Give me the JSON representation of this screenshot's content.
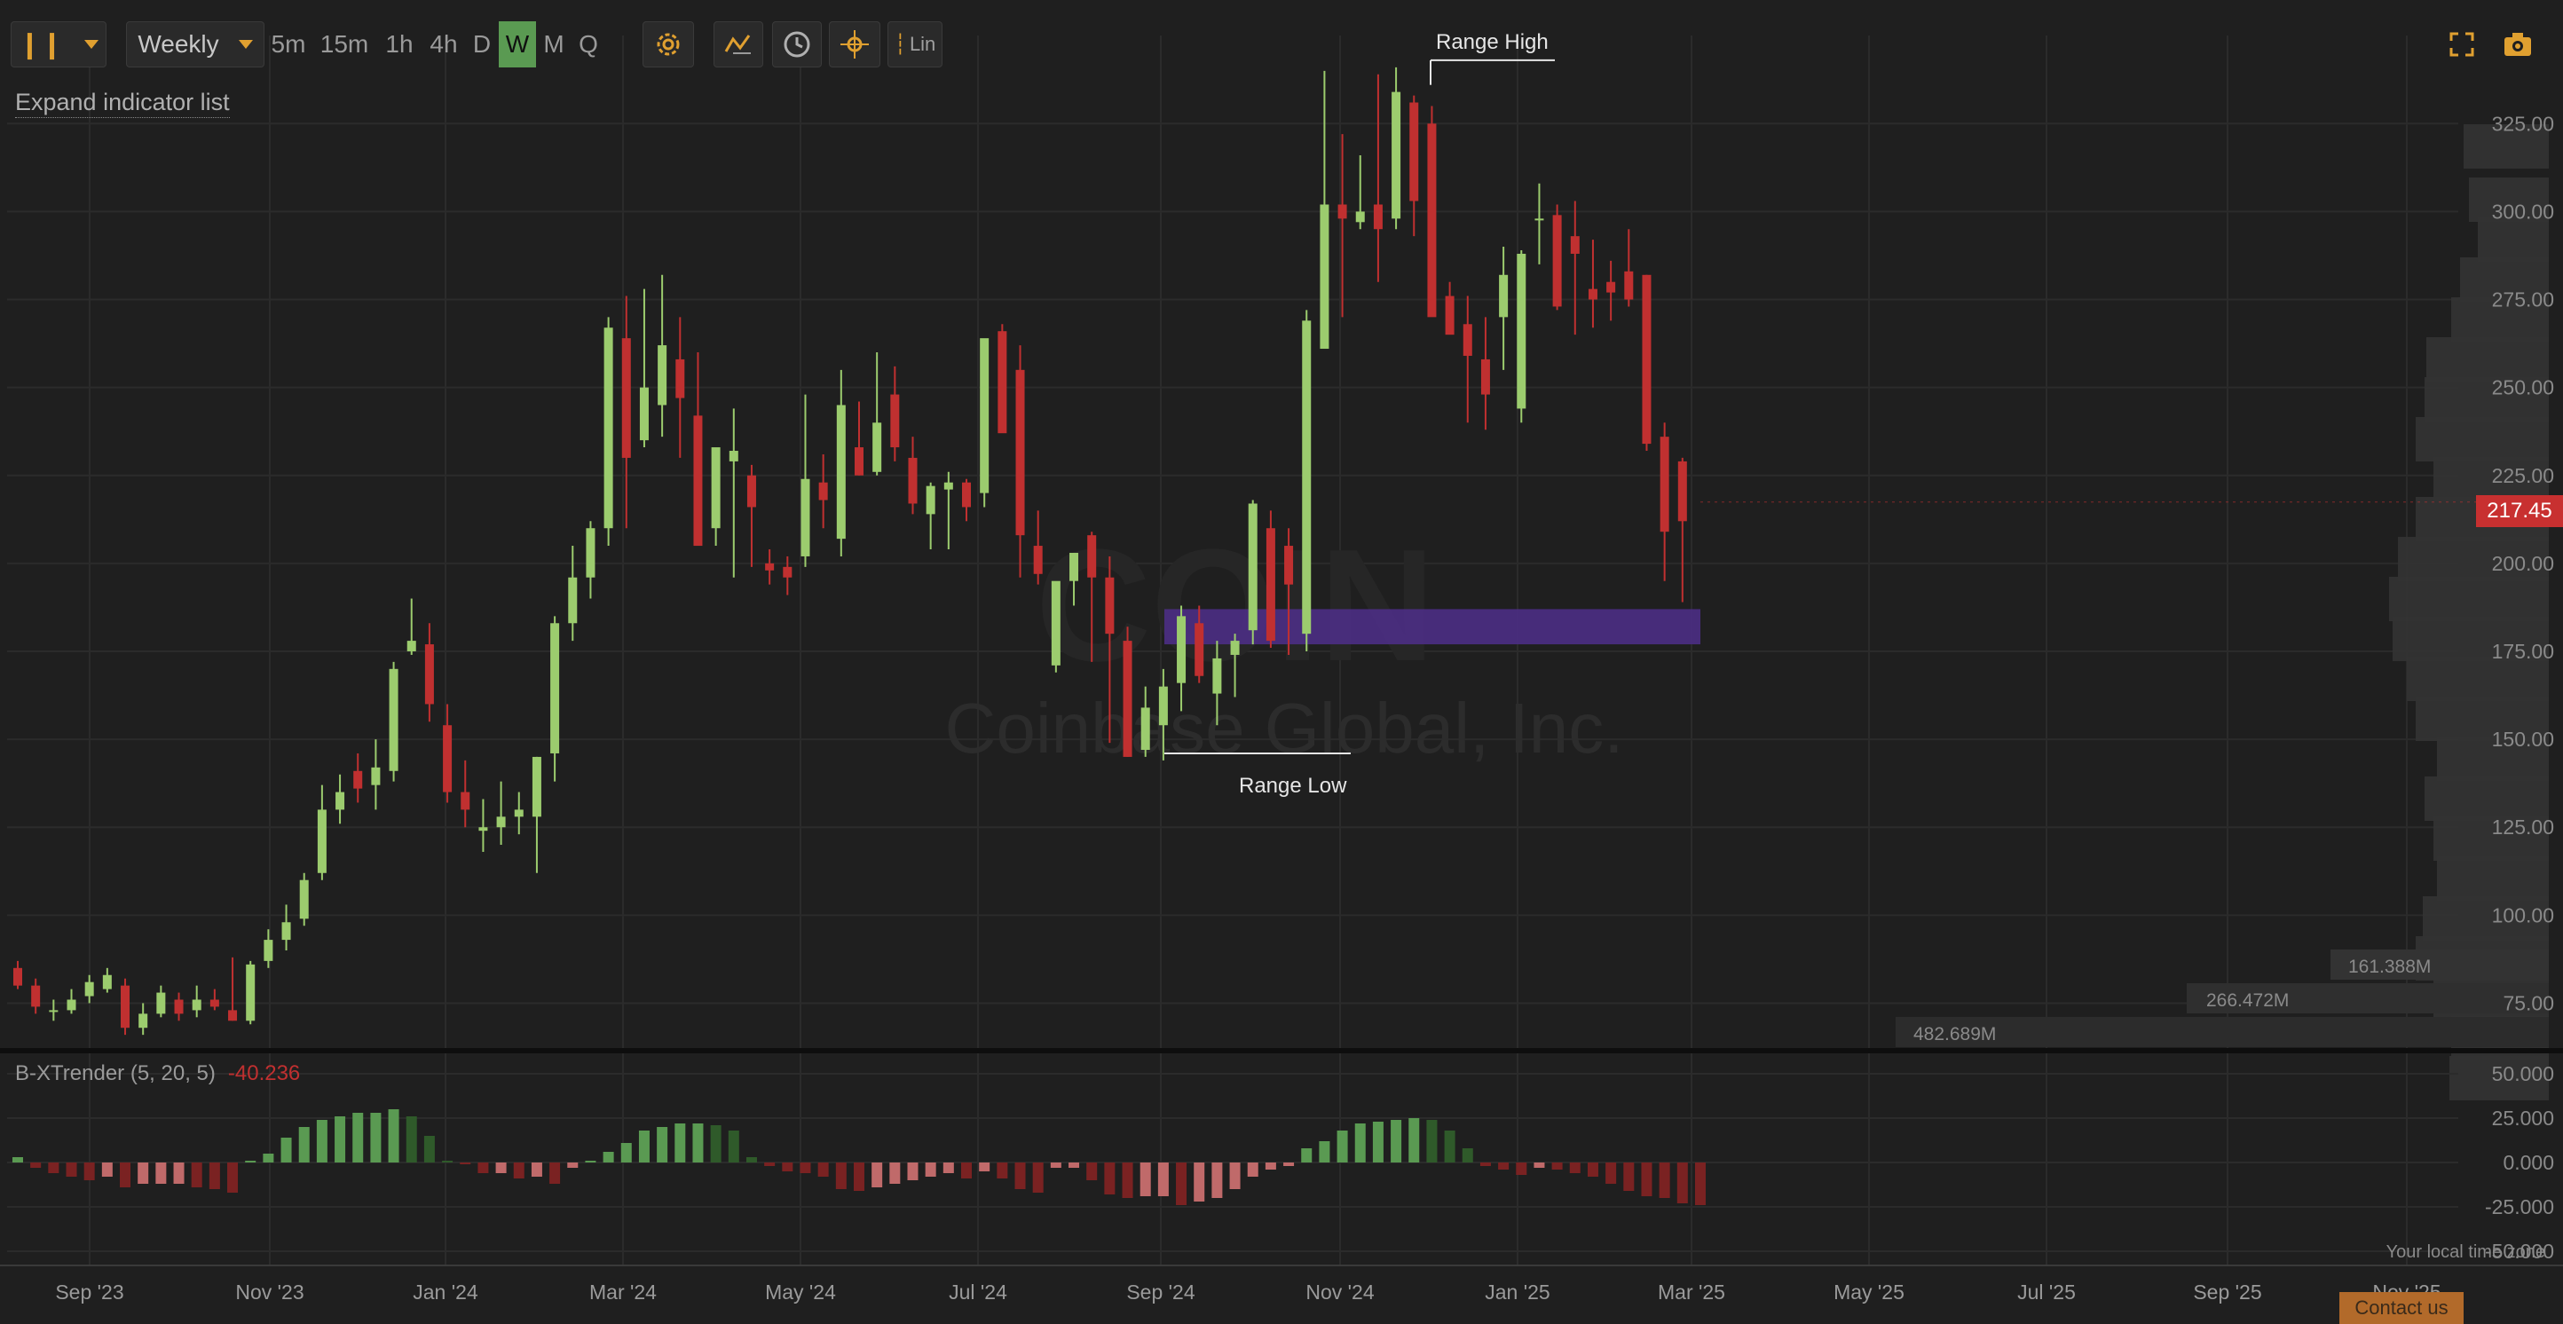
{
  "toolbar": {
    "timeframe": "Weekly",
    "intervals": [
      "5m",
      "15m",
      "1h",
      "4h",
      "D",
      "W",
      "M",
      "Q"
    ],
    "active_interval": "W",
    "scale_label": "Lin"
  },
  "expand_indicator_label": "Expand indicator list",
  "watermark": {
    "symbol": "COIN",
    "company": "Coinbase Global, Inc."
  },
  "annotations": {
    "range_high": "Range High",
    "range_low": "Range Low"
  },
  "current_price": "217.45",
  "volume_profile_labels": [
    "161.388M",
    "266.472M",
    "482.689M"
  ],
  "indicator": {
    "title": "B-XTrender (5, 20, 5)",
    "value": "-40.236"
  },
  "timezone_label": "Your local time zone",
  "contact_label": "Contact us",
  "colors": {
    "up": "#9ccc6e",
    "down": "#c03030",
    "zone": "#4a2d80"
  },
  "chart_data": [
    {
      "type": "candlestick",
      "interval": "weekly",
      "ylim": [
        62,
        345
      ],
      "yticks": [
        "75.00",
        "100.00",
        "125.00",
        "150.00",
        "175.00",
        "200.00",
        "225.00",
        "250.00",
        "275.00",
        "300.00",
        "325.00"
      ],
      "xticks": [
        "Sep '23",
        "Nov '23",
        "Jan '24",
        "Mar '24",
        "May '24",
        "Jul '24",
        "Sep '24",
        "Nov '24",
        "Jan '25",
        "Mar '25",
        "May '25",
        "Jul '25",
        "Sep '25",
        "Nov '25"
      ],
      "candles": [
        [
          0,
          85,
          87,
          79,
          80
        ],
        [
          1,
          80,
          82,
          72,
          74
        ],
        [
          2,
          73,
          76,
          70,
          73
        ],
        [
          3,
          73,
          79,
          72,
          76
        ],
        [
          4,
          77,
          83,
          75,
          81
        ],
        [
          5,
          79,
          85,
          78,
          83
        ],
        [
          6,
          80,
          82,
          66,
          68
        ],
        [
          7,
          68,
          75,
          66,
          72
        ],
        [
          8,
          72,
          80,
          71,
          78
        ],
        [
          9,
          76,
          78,
          70,
          72
        ],
        [
          10,
          73,
          80,
          71,
          76
        ],
        [
          11,
          76,
          79,
          73,
          74
        ],
        [
          12,
          73,
          88,
          70,
          70
        ],
        [
          13,
          70,
          87,
          69,
          86
        ],
        [
          14,
          87,
          96,
          85,
          93
        ],
        [
          15,
          93,
          103,
          90,
          98
        ],
        [
          16,
          99,
          112,
          97,
          110
        ],
        [
          17,
          112,
          137,
          110,
          130
        ],
        [
          18,
          130,
          140,
          126,
          135
        ],
        [
          19,
          141,
          146,
          132,
          136
        ],
        [
          20,
          137,
          150,
          130,
          142
        ],
        [
          21,
          141,
          172,
          138,
          170
        ],
        [
          22,
          175,
          190,
          174,
          178
        ],
        [
          23,
          177,
          183,
          155,
          160
        ],
        [
          24,
          154,
          160,
          132,
          135
        ],
        [
          25,
          135,
          144,
          125,
          130
        ],
        [
          26,
          124,
          133,
          118,
          125
        ],
        [
          27,
          125,
          138,
          120,
          128
        ],
        [
          28,
          128,
          135,
          123,
          130
        ],
        [
          29,
          128,
          145,
          112,
          145
        ],
        [
          30,
          146,
          185,
          138,
          183
        ],
        [
          31,
          183,
          205,
          178,
          196
        ],
        [
          32,
          196,
          212,
          190,
          210
        ],
        [
          33,
          210,
          270,
          205,
          267
        ],
        [
          34,
          264,
          276,
          210,
          230
        ],
        [
          35,
          235,
          278,
          233,
          250
        ],
        [
          36,
          245,
          282,
          236,
          262
        ],
        [
          37,
          258,
          270,
          230,
          247
        ],
        [
          38,
          242,
          260,
          212,
          205
        ],
        [
          39,
          210,
          230,
          205,
          233
        ],
        [
          40,
          229,
          244,
          196,
          232
        ],
        [
          41,
          225,
          228,
          199,
          216
        ],
        [
          42,
          200,
          204,
          194,
          198
        ],
        [
          43,
          199,
          202,
          191,
          196
        ],
        [
          44,
          202,
          248,
          199,
          224
        ],
        [
          45,
          223,
          231,
          210,
          218
        ],
        [
          46,
          207,
          255,
          202,
          245
        ],
        [
          47,
          233,
          246,
          225,
          225
        ],
        [
          48,
          226,
          260,
          225,
          240
        ],
        [
          49,
          248,
          256,
          229,
          233
        ],
        [
          50,
          230,
          236,
          214,
          217
        ],
        [
          51,
          214,
          223,
          204,
          222
        ],
        [
          52,
          221,
          226,
          204,
          223
        ],
        [
          53,
          223,
          224,
          212,
          216
        ],
        [
          54,
          220,
          263,
          216,
          264
        ],
        [
          55,
          266,
          268,
          239,
          237
        ],
        [
          56,
          255,
          262,
          196,
          208
        ],
        [
          57,
          205,
          215,
          194,
          197
        ],
        [
          58,
          171,
          193,
          169,
          195
        ],
        [
          59,
          195,
          203,
          188,
          203
        ],
        [
          60,
          208,
          209,
          172,
          196
        ],
        [
          61,
          196,
          202,
          149,
          180
        ],
        [
          62,
          178,
          182,
          145,
          145
        ],
        [
          63,
          147,
          165,
          145,
          159
        ],
        [
          64,
          154,
          170,
          144,
          165
        ],
        [
          65,
          166,
          188,
          158,
          185
        ],
        [
          66,
          183,
          188,
          166,
          168
        ],
        [
          67,
          163,
          178,
          154,
          173
        ],
        [
          68,
          174,
          180,
          162,
          178
        ],
        [
          69,
          181,
          218,
          177,
          217
        ],
        [
          70,
          210,
          215,
          176,
          178
        ],
        [
          71,
          205,
          210,
          174,
          194
        ],
        [
          72,
          180,
          272,
          175,
          269
        ],
        [
          73,
          261,
          340,
          262,
          302
        ],
        [
          74,
          302,
          322,
          270,
          298
        ],
        [
          75,
          297,
          316,
          295,
          300
        ],
        [
          76,
          302,
          339,
          280,
          295
        ],
        [
          77,
          298,
          341,
          295,
          334
        ],
        [
          78,
          331,
          333,
          293,
          303
        ],
        [
          79,
          325,
          330,
          300,
          270
        ],
        [
          80,
          276,
          280,
          270,
          265
        ],
        [
          81,
          268,
          276,
          240,
          259
        ],
        [
          82,
          258,
          270,
          238,
          248
        ],
        [
          83,
          270,
          290,
          255,
          282
        ],
        [
          84,
          244,
          289,
          240,
          288
        ],
        [
          85,
          298,
          308,
          285,
          298
        ],
        [
          86,
          299,
          302,
          272,
          273
        ],
        [
          87,
          293,
          303,
          265,
          288
        ],
        [
          88,
          278,
          292,
          267,
          275
        ],
        [
          89,
          280,
          286,
          269,
          277
        ],
        [
          90,
          283,
          295,
          273,
          275
        ],
        [
          91,
          282,
          282,
          232,
          234
        ],
        [
          92,
          236,
          240,
          195,
          209
        ],
        [
          93,
          229,
          230,
          189,
          212
        ]
      ]
    },
    {
      "type": "bar",
      "title": "B-XTrender (5, 20, 5)",
      "ylim": [
        -58,
        55
      ],
      "yticks": [
        "50.000",
        "25.000",
        "0.000",
        "-25.000",
        "-50.000"
      ],
      "values": [
        3,
        -3,
        -6,
        -8,
        -10,
        -8,
        -14,
        -12,
        -12,
        -12,
        -14,
        -15,
        -17,
        1,
        5,
        14,
        20,
        24,
        26,
        28,
        28,
        30,
        26,
        15,
        1,
        -1,
        -6,
        -6,
        -9,
        -8,
        -12,
        -3,
        1,
        6,
        11,
        18,
        20,
        22,
        22,
        21,
        18,
        3,
        -2,
        -5,
        -6,
        -8,
        -15,
        -16,
        -14,
        -12,
        -10,
        -8,
        -6,
        -9,
        -5,
        -9,
        -15,
        -17,
        -3,
        -3,
        -10,
        -18,
        -20,
        -19,
        -19,
        -24,
        -22,
        -20,
        -15,
        -8,
        -4,
        -2,
        8,
        12,
        18,
        22,
        23,
        24,
        25,
        24,
        18,
        8,
        -2,
        -4,
        -7,
        -3,
        -4,
        -6,
        -8,
        -12,
        -16,
        -19,
        -20,
        -23,
        -24
      ]
    }
  ]
}
